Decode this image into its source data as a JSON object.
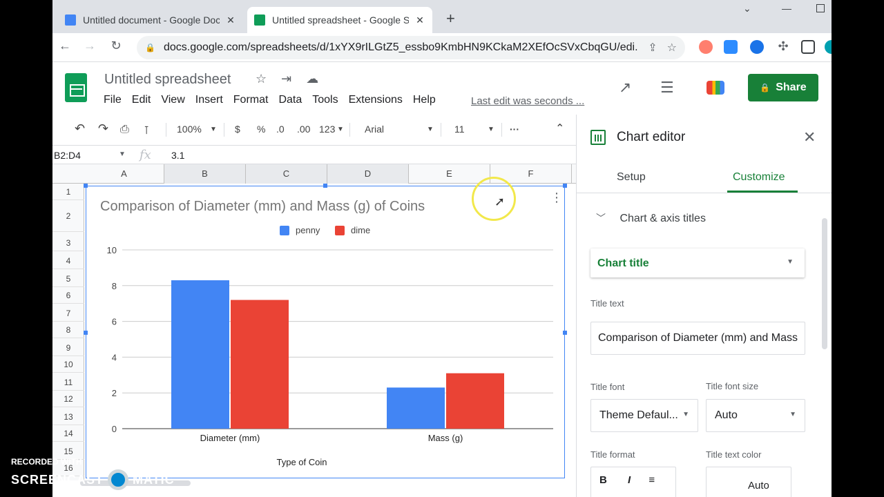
{
  "browser": {
    "tabs": [
      {
        "title": "Untitled document - Google Doc",
        "favicon_color": "#4285f4",
        "active": false
      },
      {
        "title": "Untitled spreadsheet - Google Sl",
        "favicon_color": "#0f9d58",
        "active": true
      }
    ],
    "url": "docs.google.com/spreadsheets/d/1xYX9rILGtZ5_essbo9KmbHN9KCkaM2XEfOcSVxCbqGU/edi..."
  },
  "app": {
    "doc_title": "Untitled spreadsheet",
    "menus": [
      "File",
      "Edit",
      "View",
      "Insert",
      "Format",
      "Data",
      "Tools",
      "Extensions",
      "Help"
    ],
    "last_edit": "Last edit was seconds ...",
    "share_label": "Share",
    "brand_green": "#188038"
  },
  "toolbar": {
    "zoom": "100%",
    "currency": "$",
    "percent": "%",
    "dec_less": ".0",
    "dec_more": ".00",
    "format_more": "123",
    "font": "Arial",
    "font_size": "11"
  },
  "formula": {
    "name_box": "B2:D4",
    "fx": "fx",
    "value": "3.1"
  },
  "grid": {
    "columns": [
      "A",
      "B",
      "C",
      "D",
      "E",
      "F"
    ],
    "rows": [
      "1",
      "2",
      "3",
      "4",
      "5",
      "6",
      "7",
      "8",
      "9",
      "10",
      "11",
      "12",
      "13",
      "14",
      "15",
      "16"
    ]
  },
  "chart_data": {
    "type": "bar",
    "title": "Comparison of Diameter (mm) and Mass (g) of Coins",
    "xlabel": "Type of Coin",
    "ylabel": "",
    "categories": [
      "Diameter (mm)",
      "Mass (g)"
    ],
    "series": [
      {
        "name": "penny",
        "values": [
          8.3,
          2.3
        ],
        "color": "#4285f4"
      },
      {
        "name": "dime",
        "values": [
          7.2,
          3.1
        ],
        "color": "#ea4335"
      }
    ],
    "ylim": [
      0,
      10
    ],
    "yticks": [
      0,
      2,
      4,
      6,
      8,
      10
    ],
    "legend": "top",
    "grid": true
  },
  "editor": {
    "title": "Chart editor",
    "tabs": [
      "Setup",
      "Customize"
    ],
    "active_tab": "Customize",
    "section": "Chart & axis titles",
    "dropdown_value": "Chart title",
    "title_text_label": "Title text",
    "title_text_value": "Comparison of Diameter (mm) and Mass",
    "title_font_label": "Title font",
    "title_font_value": "Theme Defaul...",
    "title_font_size_label": "Title font size",
    "title_font_size_value": "Auto",
    "title_format_label": "Title format",
    "title_text_color_label": "Title text color",
    "title_text_color_value": "Auto"
  },
  "watermark": {
    "recorded": "RECORDED WITH",
    "left": "SCREENCAST",
    "right": "MATIC"
  }
}
